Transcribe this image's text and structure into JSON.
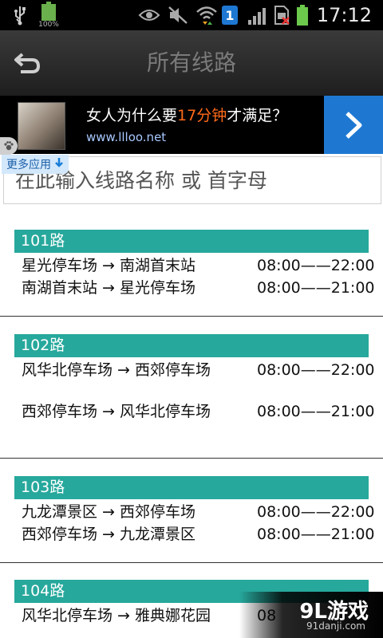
{
  "statusbar": {
    "time": "17:12",
    "battery_percent_label": "100%",
    "notification_count": "1",
    "icons": [
      "usb-icon",
      "battery-full-icon",
      "eye-icon",
      "mute-icon",
      "wifi-icon",
      "notification-badge-icon",
      "signal-icon",
      "no-sim-icon",
      "battery-icon"
    ]
  },
  "header": {
    "title": "所有线路",
    "back_icon": "back-arrow-icon"
  },
  "ad": {
    "title_pre": "女人为什么要",
    "title_highlight": "17分钟",
    "title_post": "才满足？",
    "url": "www.llloo.net",
    "arrow_icon": "chevron-right-icon"
  },
  "more_apps": {
    "label": "更多应用",
    "icon": "download-arrow-icon"
  },
  "search": {
    "placeholder": "在此输入线路名称 或 首字母",
    "value": ""
  },
  "routes": [
    {
      "name": "101路",
      "directions": [
        {
          "path": "星光停车场 → 南湖首末站",
          "time": "08:00——22:00"
        },
        {
          "path": "南湖首末站 → 星光停车场",
          "time": "08:00——21:00"
        }
      ]
    },
    {
      "name": "102路",
      "directions": [
        {
          "path": "风华北停车场 → 西郊停车场",
          "time": "08:00——22:00"
        },
        {
          "path": "西郊停车场 → 风华北停车场",
          "time": "08:00——21:00"
        }
      ]
    },
    {
      "name": "103路",
      "directions": [
        {
          "path": "九龙潭景区 → 西郊停车场",
          "time": "08:00——22:00"
        },
        {
          "path": "西郊停车场 → 九龙潭景区",
          "time": "08:00——21:00"
        }
      ]
    },
    {
      "name": "104路",
      "directions": [
        {
          "path": "风华北停车场 → 雅典娜花园",
          "time": "08"
        }
      ]
    }
  ],
  "watermark": {
    "logo": "9L游戏",
    "url": "91danji.com"
  },
  "colors": {
    "route_header_bg": "#27a89c",
    "ad_accent": "#1e78d2",
    "highlight": "#ff6a1a"
  }
}
